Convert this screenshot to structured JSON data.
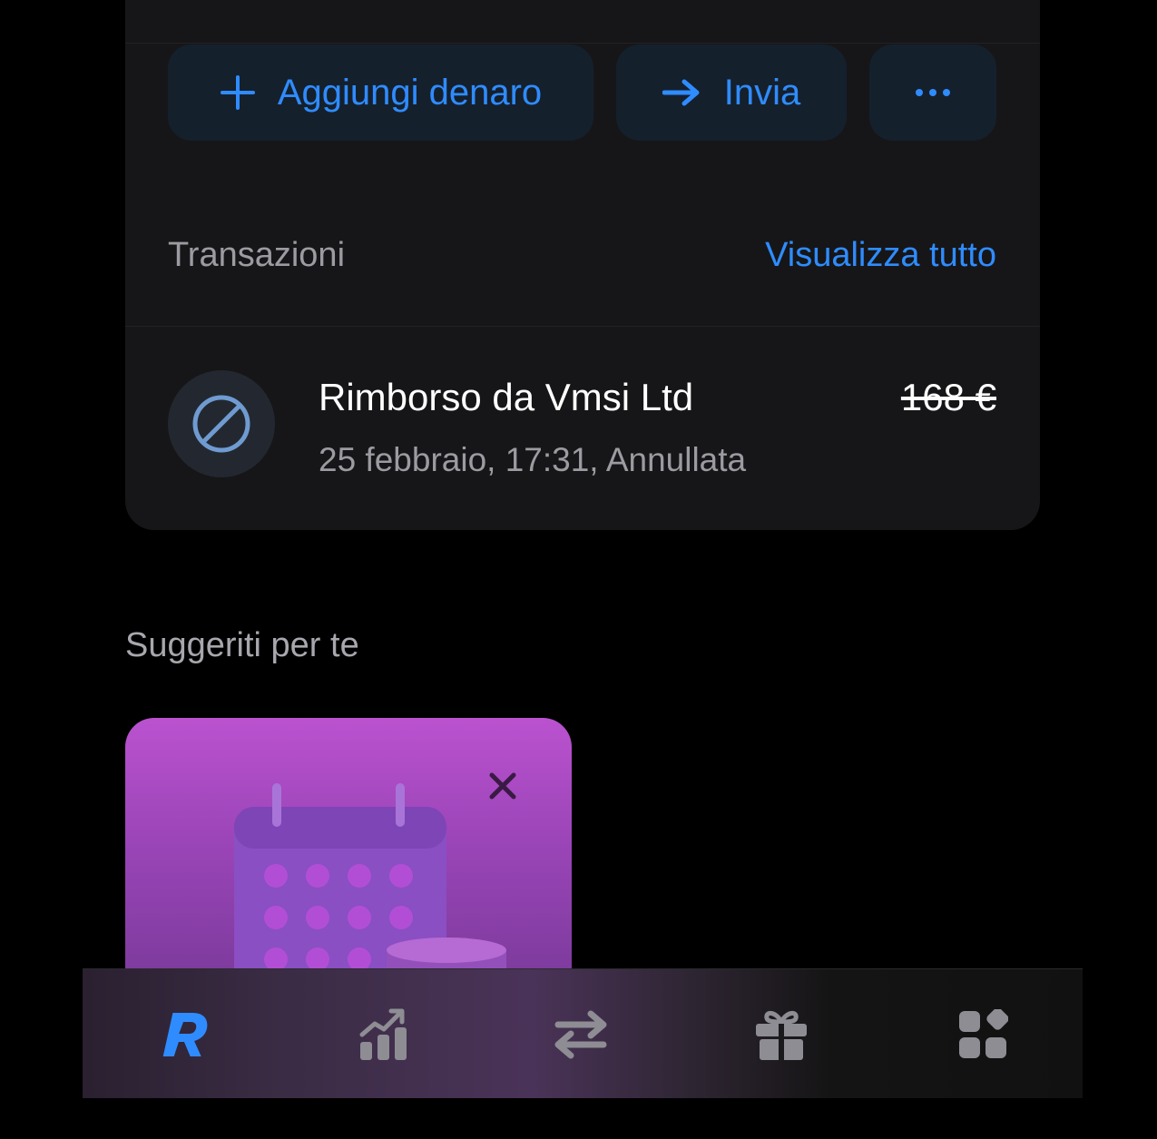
{
  "actions": {
    "add_money": "Aggiungi denaro",
    "send": "Invia"
  },
  "transactions": {
    "title": "Transazioni",
    "view_all": "Visualizza tutto",
    "items": [
      {
        "name": "Rimborso da Vmsi Ltd",
        "subtitle": "25 febbraio, 17:31, Annullata",
        "amount": "168 €",
        "icon": "cancelled-icon",
        "status": "cancelled"
      }
    ]
  },
  "suggestions": {
    "title": "Suggeriti per te",
    "cards": [
      {
        "illustration": "calendar-coins-illustration",
        "close_icon": "close-icon"
      }
    ]
  },
  "tabbar": {
    "items": [
      {
        "icon": "revolut-home-icon",
        "active": true
      },
      {
        "icon": "invest-chart-icon",
        "active": false
      },
      {
        "icon": "transfer-arrows-icon",
        "active": false
      },
      {
        "icon": "gift-icon",
        "active": false
      },
      {
        "icon": "hub-grid-icon",
        "active": false
      }
    ]
  },
  "colors": {
    "accent": "#2f8cff",
    "card_bg": "#161618",
    "button_bg": "#15202d",
    "muted_text": "#9b9ba1",
    "promo_gradient_top": "#bb52cf"
  }
}
